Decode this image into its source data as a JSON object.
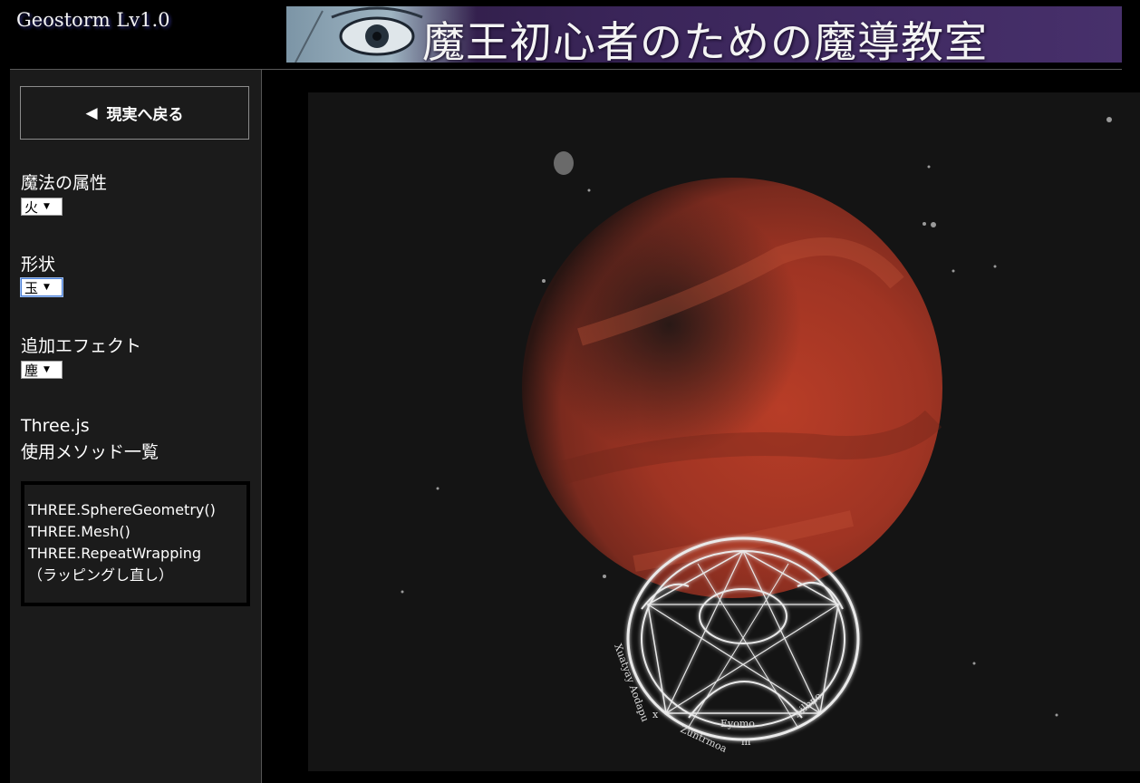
{
  "app": {
    "title": "Geostorm Lv1.0"
  },
  "banner": {
    "text": "魔王初心者のための魔導教室"
  },
  "sidebar": {
    "back_button_label": "現実へ戻る",
    "fields": [
      {
        "label": "魔法の属性",
        "value": "火"
      },
      {
        "label": "形状",
        "value": "玉"
      },
      {
        "label": "追加エフェクト",
        "value": "塵"
      }
    ],
    "methods_title": [
      "Three.js",
      "使用メソッド一覧"
    ],
    "methods": [
      "THREE.SphereGeometry()",
      "THREE.Mesh()",
      "THREE.RepeatWrapping",
      "（ラッピングし直し）"
    ]
  },
  "scene": {
    "sphere_color": "#b23a22",
    "circle_color": "#e8e8e8",
    "background": "#141414"
  }
}
